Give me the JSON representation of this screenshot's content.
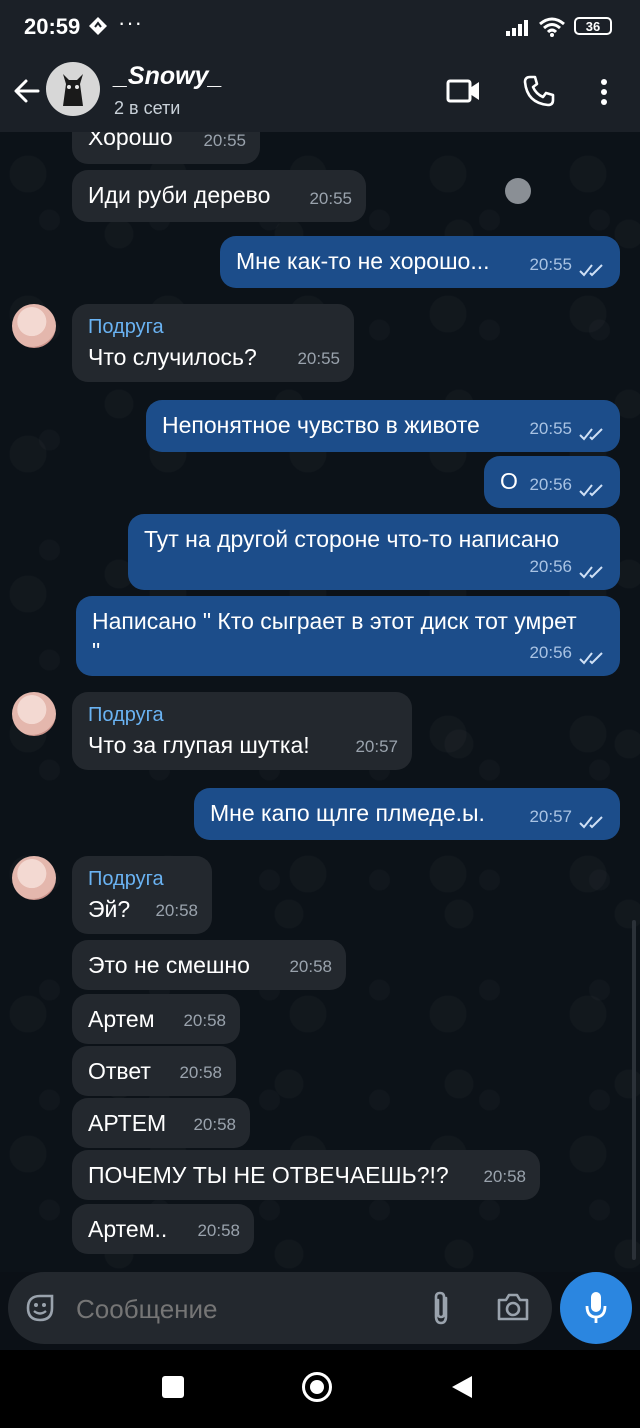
{
  "status_bar": {
    "time": "20:59",
    "battery": "36"
  },
  "header": {
    "title": "_Snowy_",
    "subtitle": "2 в сети"
  },
  "messages": [
    {
      "dir": "in",
      "text": "Хорошо",
      "time": "20:55"
    },
    {
      "dir": "in",
      "text": "Иди руби дерево",
      "time": "20:55"
    },
    {
      "dir": "out",
      "text": "Мне как-то не хорошо...",
      "time": "20:55"
    },
    {
      "dir": "in",
      "sender": "Подруга",
      "text": "Что случилось?",
      "time": "20:55"
    },
    {
      "dir": "out",
      "text": "Непонятное чувство в животе",
      "time": "20:55"
    },
    {
      "dir": "out",
      "text": "О",
      "time": "20:56"
    },
    {
      "dir": "out",
      "text": "Тут на другой стороне что-то написано",
      "time": "20:56"
    },
    {
      "dir": "out",
      "text": "Написано \" Кто сыграет в этот диск тот умрет \"",
      "time": "20:56"
    },
    {
      "dir": "in",
      "sender": "Подруга",
      "text": "Что за глупая шутка!",
      "time": "20:57"
    },
    {
      "dir": "out",
      "text": "Мне капо щлге плмеде.ы.",
      "time": "20:57"
    },
    {
      "dir": "in",
      "sender": "Подруга",
      "text": "Эй?",
      "time": "20:58"
    },
    {
      "dir": "in",
      "text": "Это не смешно",
      "time": "20:58"
    },
    {
      "dir": "in",
      "text": "Артем",
      "time": "20:58"
    },
    {
      "dir": "in",
      "text": "Ответ",
      "time": "20:58"
    },
    {
      "dir": "in",
      "text": "АРТЕМ",
      "time": "20:58"
    },
    {
      "dir": "in",
      "text": "ПОЧЕМУ ТЫ НЕ ОТВЕЧАЕШЬ?!?",
      "time": "20:58"
    },
    {
      "dir": "in",
      "text": "Артем..",
      "time": "20:58"
    }
  ],
  "composer": {
    "placeholder": "Сообщение"
  },
  "colors": {
    "incoming": "#23282e",
    "outgoing": "#1c4d8a",
    "accent": "#2b86e0",
    "sender": "#6ab3f3"
  },
  "icons": [
    "back-arrow-icon",
    "video-call-icon",
    "phone-icon",
    "more-vert-icon",
    "sticker-icon",
    "attach-icon",
    "camera-icon",
    "mic-icon",
    "read-ticks-icon"
  ]
}
